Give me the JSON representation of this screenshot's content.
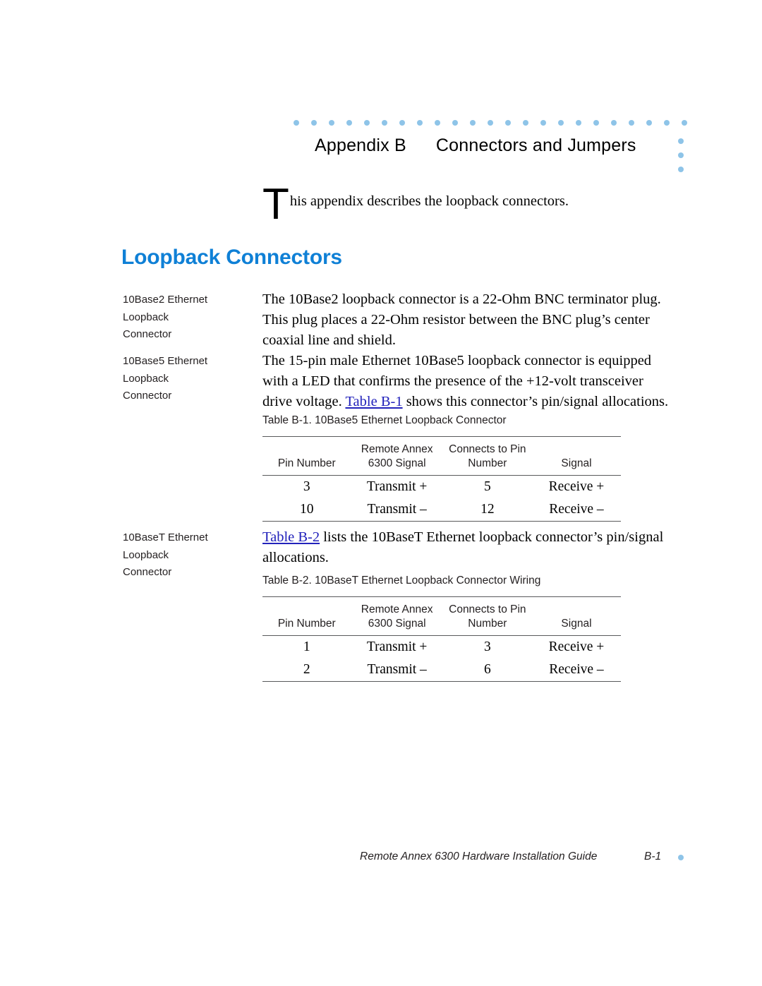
{
  "document": {
    "appendix_label": "Appendix B",
    "appendix_name": "Connectors and Jumpers",
    "intro_dropcap": "T",
    "intro_text": "his appendix describes the loopback connectors.",
    "section_heading": "Loopback Connectors"
  },
  "colors": {
    "heading_blue": "#0f80d6",
    "dot_blue": "#8ec4e8",
    "link_blue": "#2222bb",
    "rule_gray": "#58595b",
    "text_black": "#231f20"
  },
  "decoration": {
    "dot_row_count": 23,
    "dot_row_spacing": 25,
    "dot_column_count": 3,
    "dot_column_spacing": 20
  },
  "margin_notes": [
    {
      "lines": [
        "10Base2 Ethernet",
        "Loopback",
        "Connector"
      ]
    },
    {
      "lines": [
        "10Base5 Ethernet",
        "Loopback",
        "Connector"
      ]
    },
    {
      "lines": [
        "10BaseT Ethernet",
        "Loopback",
        "Connector"
      ]
    }
  ],
  "paragraphs": {
    "base2": "The 10Base2 loopback connector is a 22-Ohm BNC terminator plug. This plug places a 22-Ohm resistor between the BNC plug’s center coaxial line and shield.",
    "base5_pre": "The 15-pin male Ethernet 10Base5 loopback connector is equipped with a LED that confirms the presence of the +12-volt transceiver drive voltage. ",
    "base5_link": "Table B-1",
    "base5_post": " shows this connector’s pin/signal allocations.",
    "baset_link": "Table B-2",
    "baset_post": " lists the 10BaseT Ethernet loopback connector’s pin/signal allocations."
  },
  "tables": [
    {
      "caption": "Table B-1. 10Base5 Ethernet Loopback Connector",
      "headers": [
        [
          "",
          "Pin Number"
        ],
        [
          "Remote Annex",
          "6300 Signal"
        ],
        [
          "Connects to Pin",
          "Number"
        ],
        [
          "",
          "Signal"
        ]
      ],
      "rows": [
        [
          "3",
          "Transmit +",
          "5",
          "Receive +"
        ],
        [
          "10",
          "Transmit –",
          "12",
          "Receive –"
        ]
      ]
    },
    {
      "caption": "Table B-2. 10BaseT Ethernet Loopback Connector Wiring",
      "headers": [
        [
          "",
          "Pin Number"
        ],
        [
          "Remote Annex",
          "6300 Signal"
        ],
        [
          "Connects to Pin",
          "Number"
        ],
        [
          "",
          "Signal"
        ]
      ],
      "rows": [
        [
          "1",
          "Transmit +",
          "3",
          "Receive +"
        ],
        [
          "2",
          "Transmit –",
          "6",
          "Receive –"
        ]
      ]
    }
  ],
  "footer": {
    "title": "Remote Annex 6300 Hardware Installation Guide",
    "page": "B-1"
  }
}
